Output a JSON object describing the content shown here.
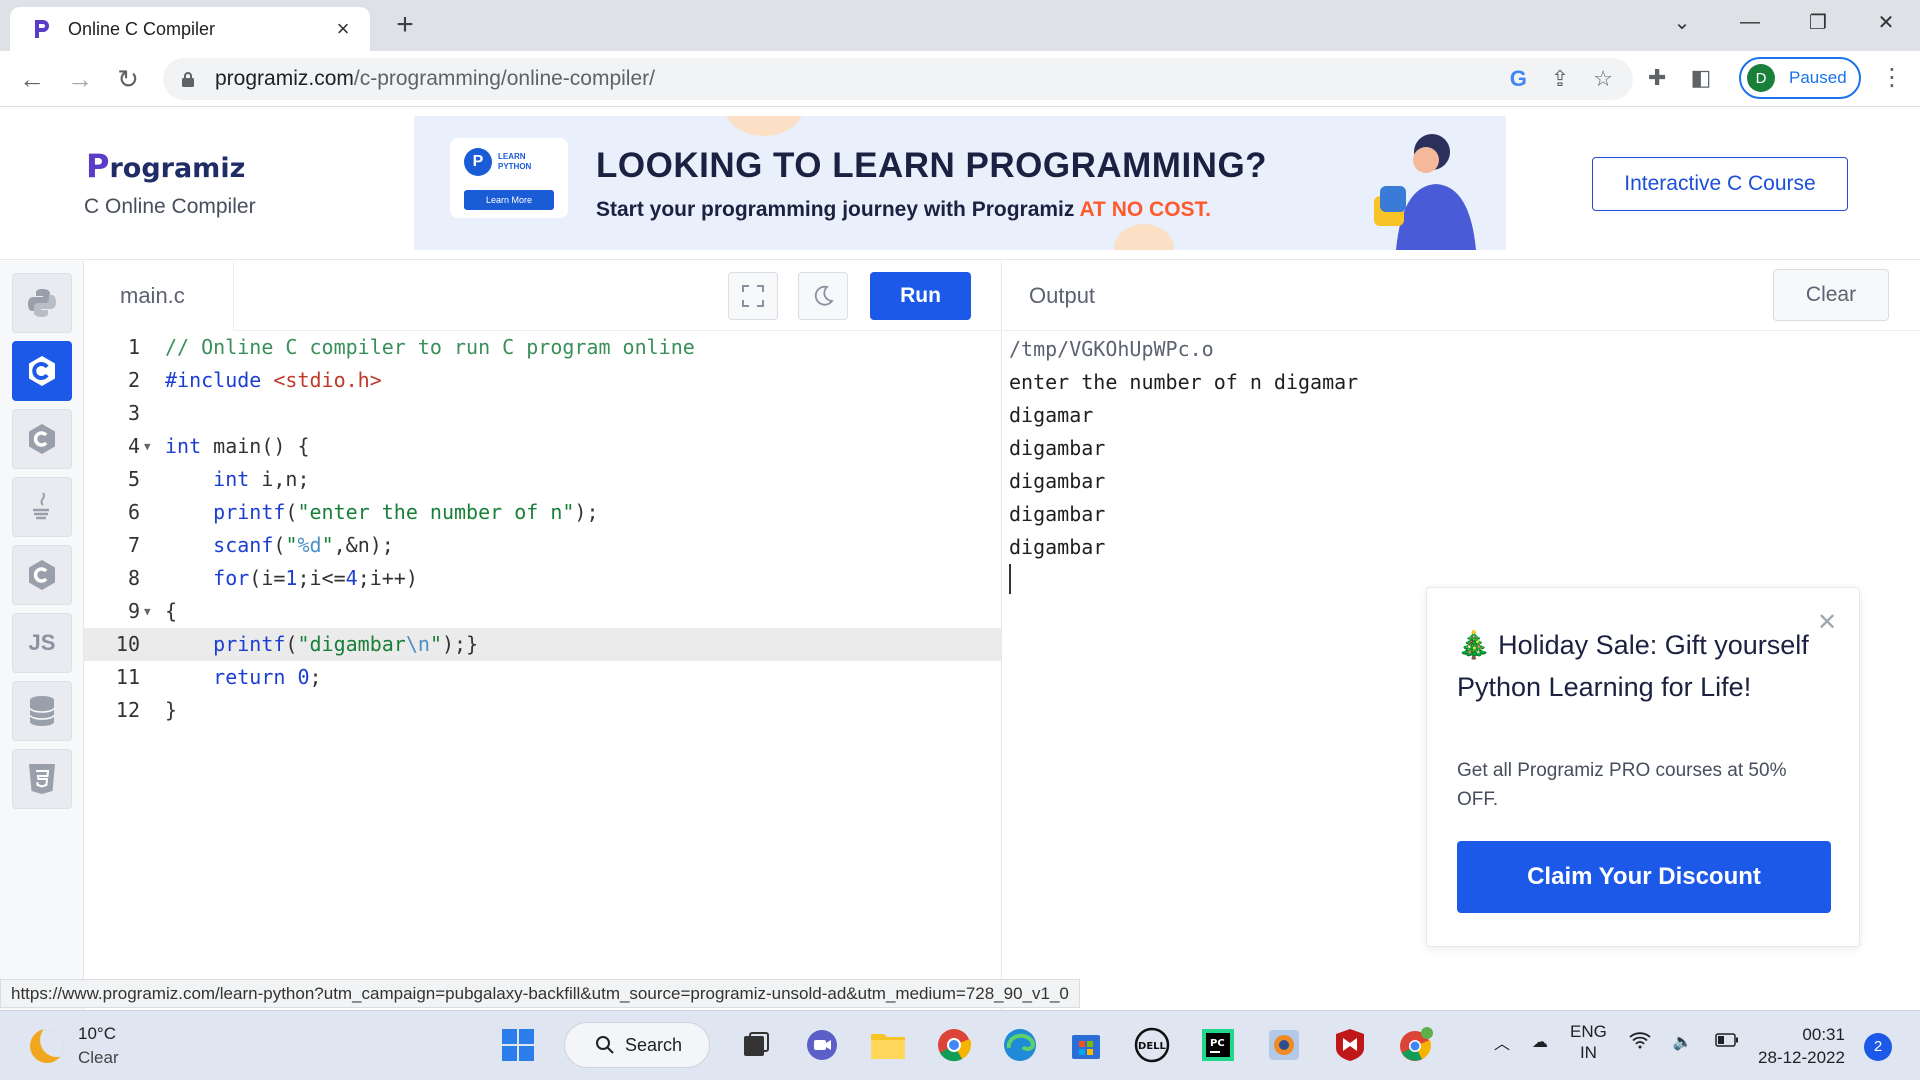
{
  "browser": {
    "tab_title": "Online C Compiler",
    "url_host": "programiz.com",
    "url_path": "/c-programming/online-compiler/",
    "profile_initial": "D",
    "profile_status": "Paused"
  },
  "header": {
    "logo_text": "rogramiz",
    "logo_initial": "P",
    "subtitle": "C Online Compiler",
    "course_button": "Interactive C Course"
  },
  "banner": {
    "badge_line1": "LEARN",
    "badge_line2": "PYTHON",
    "learn_more": "Learn More",
    "headline": "LOOKING TO LEARN PROGRAMMING?",
    "sub_before": "Start your programming journey with Programiz ",
    "sub_highlight": "AT NO COST."
  },
  "languages": [
    {
      "name": "python",
      "label": ""
    },
    {
      "name": "c",
      "label": ""
    },
    {
      "name": "cpp",
      "label": ""
    },
    {
      "name": "java",
      "label": ""
    },
    {
      "name": "csharp",
      "label": ""
    },
    {
      "name": "js",
      "label": "JS"
    },
    {
      "name": "sql",
      "label": ""
    },
    {
      "name": "html",
      "label": ""
    }
  ],
  "editor": {
    "file_name": "main.c",
    "run_label": "Run",
    "line_numbers": [
      "1",
      "2",
      "3",
      "4",
      "5",
      "6",
      "7",
      "8",
      "9",
      "10",
      "11",
      "12"
    ]
  },
  "output": {
    "label": "Output",
    "clear_label": "Clear",
    "lines": [
      "/tmp/VGKOhUpWPc.o",
      "enter the number of n digamar",
      "digamar",
      "digambar",
      "digambar",
      "digambar",
      "digambar"
    ]
  },
  "promo": {
    "title": "🎄 Holiday Sale: Gift yourself Python Learning for Life!",
    "text": "Get all Programiz PRO courses at 50% OFF.",
    "button": "Claim Your Discount"
  },
  "status_url": "https://www.programiz.com/learn-python?utm_campaign=pubgalaxy-backfill&utm_source=programiz-unsold-ad&utm_medium=728_90_v1_0",
  "taskbar": {
    "temperature": "10°C",
    "weather": "Clear",
    "search_label": "Search",
    "lang_line1": "ENG",
    "lang_line2": "IN",
    "time": "00:31",
    "date": "28-12-2022",
    "notifications": "2"
  },
  "colors": {
    "accent": "#1c59e8",
    "brand_text": "#1b2140",
    "highlight": "#ff5a2e"
  }
}
